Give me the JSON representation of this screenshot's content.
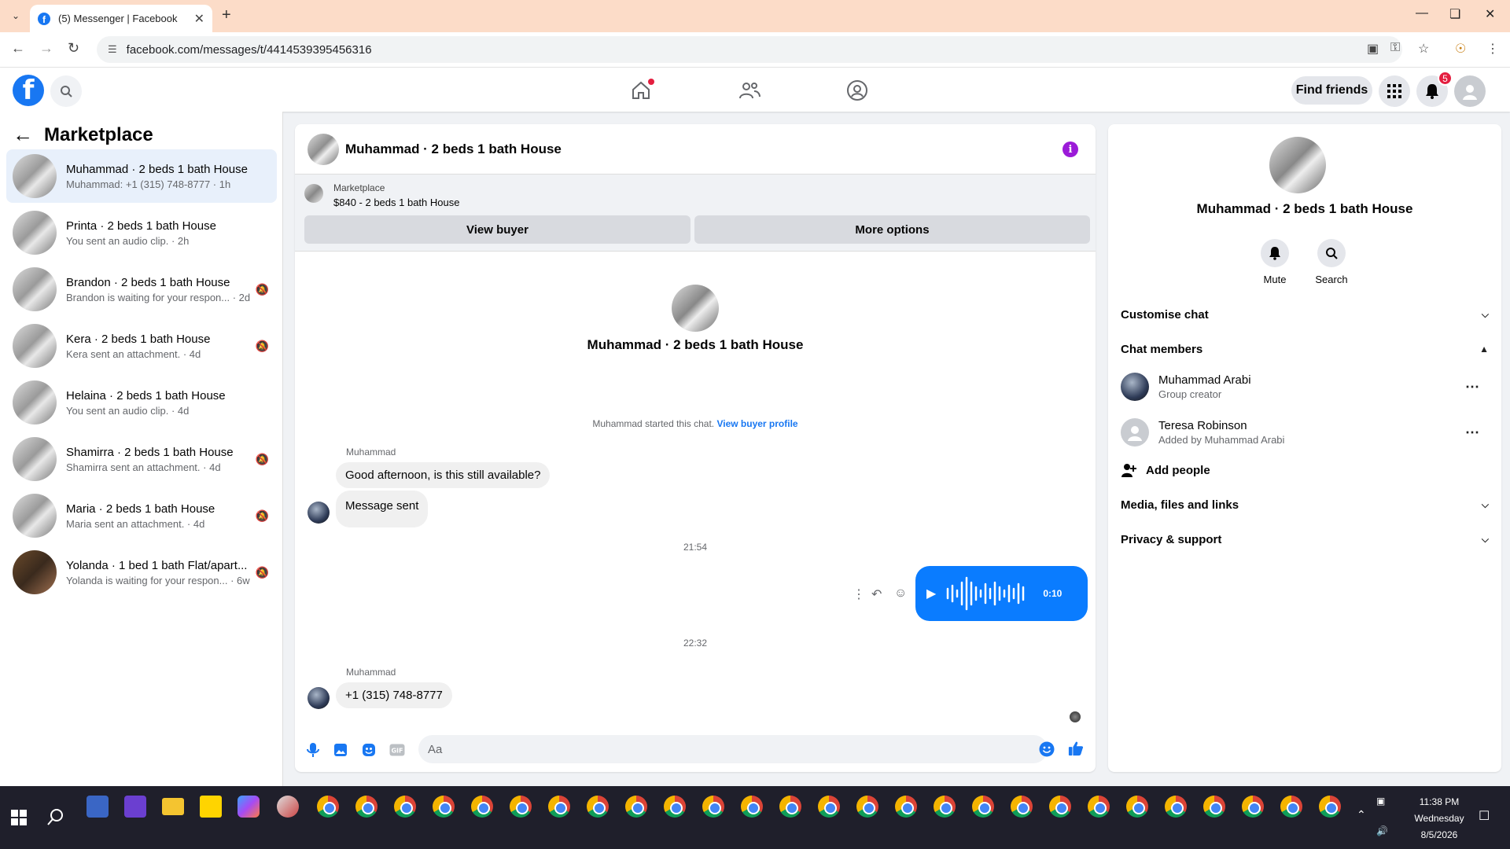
{
  "browser": {
    "tab_title": "(5) Messenger | Facebook",
    "url": "facebook.com/messages/t/4414539395456316"
  },
  "header": {
    "find_friends": "Find friends",
    "notification_count": "5"
  },
  "sidebar": {
    "title": "Marketplace",
    "conversations": [
      {
        "name": "Muhammad · 2 beds 1 bath House",
        "preview": "Muhammad: +1 (315) 748-8777 · 1h",
        "muted": false
      },
      {
        "name": "Printa · 2 beds 1 bath House",
        "preview": "You sent an audio clip. · 2h",
        "muted": false
      },
      {
        "name": "Brandon · 2 beds 1 bath House",
        "preview": "Brandon is waiting for your respon... · 2d",
        "muted": true
      },
      {
        "name": "Kera · 2 beds 1 bath House",
        "preview": "Kera sent an attachment. · 4d",
        "muted": true
      },
      {
        "name": "Helaina · 2 beds 1 bath House",
        "preview": "You sent an audio clip. · 4d",
        "muted": false
      },
      {
        "name": "Shamirra · 2 beds 1 bath House",
        "preview": "Shamirra sent an attachment. · 4d",
        "muted": true
      },
      {
        "name": "Maria · 2 beds 1 bath House",
        "preview": "Maria sent an attachment. · 4d",
        "muted": true
      },
      {
        "name": "Yolanda · 1 bed 1 bath Flat/apart...",
        "preview": "Yolanda is waiting for your respon... · 6w",
        "muted": true
      }
    ]
  },
  "chat": {
    "title": "Muhammad · 2 beds 1 bath House",
    "marketplace_label": "Marketplace",
    "listing": "$840 - 2 beds 1 bath House",
    "view_buyer": "View buyer",
    "more_options": "More options",
    "started_text": "Muhammad started this chat.",
    "view_buyer_profile": "View buyer profile",
    "sender1": "Muhammad",
    "msg1": "Good afternoon, is this still available?",
    "msg2": "Message sent",
    "time1": "21:54",
    "audio_duration": "0:10",
    "time2": "22:32",
    "sender2": "Muhammad",
    "msg3": "+1 (315) 748-8777",
    "input_placeholder": "Aa"
  },
  "info_panel": {
    "name": "Muhammad · 2 beds 1 bath House",
    "mute": "Mute",
    "search": "Search",
    "customise_chat": "Customise chat",
    "chat_members": "Chat members",
    "members": [
      {
        "name": "Muhammad Arabi",
        "role": "Group creator"
      },
      {
        "name": "Teresa Robinson",
        "role": "Added by Muhammad Arabi"
      }
    ],
    "add_people": "Add people",
    "media": "Media, files and links",
    "privacy": "Privacy & support"
  },
  "taskbar": {
    "time": "11:38 PM",
    "day": "Wednesday",
    "date": "8/5/2026"
  },
  "colors": {
    "brand": "#1877f2",
    "audio_bubble": "#0a7cff",
    "info_icon": "#9b1bd8",
    "badge": "#e41e3f"
  }
}
